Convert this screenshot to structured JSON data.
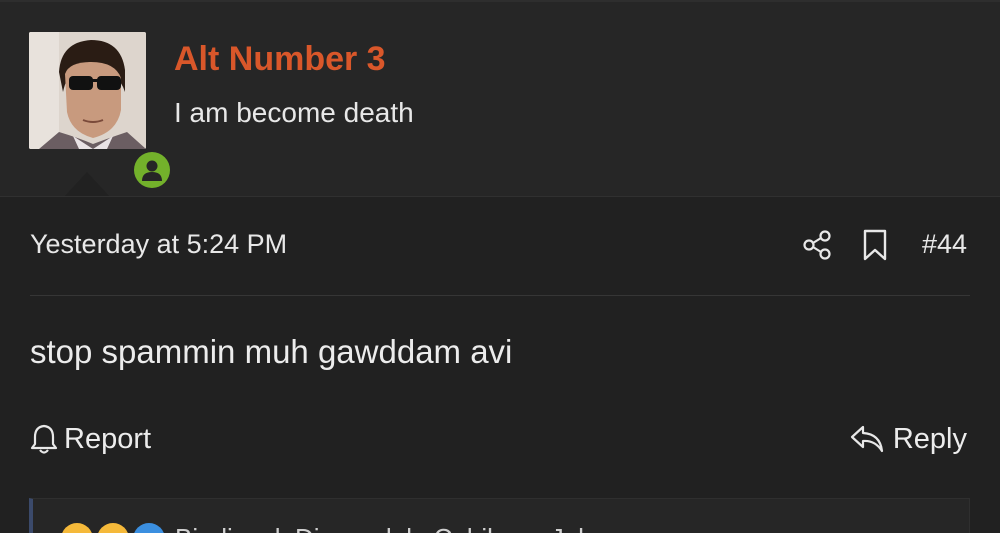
{
  "user": {
    "name": "Alt Number 3",
    "title": "I am become death",
    "online": true
  },
  "post": {
    "timestamp": "Yesterday at 5:24 PM",
    "number": "#44",
    "body": "stop spammin muh gawddam avi"
  },
  "actions": {
    "report_label": "Report",
    "reply_label": "Reply"
  },
  "reactions": {
    "emojis": [
      "laugh-emoji",
      "laugh-emoji",
      "like-emoji"
    ],
    "text": "Biodiesel, Dimmadale Cubikers, John..."
  },
  "icons": {
    "share": "share-icon",
    "bookmark": "bookmark-icon",
    "bell": "bell-icon",
    "reply": "reply-icon",
    "online": "user-online-icon"
  },
  "colors": {
    "background": "#212121",
    "header_background": "#262626",
    "username": "#d9572a",
    "online_badge": "#73b12b",
    "text": "#e8e8e8"
  }
}
